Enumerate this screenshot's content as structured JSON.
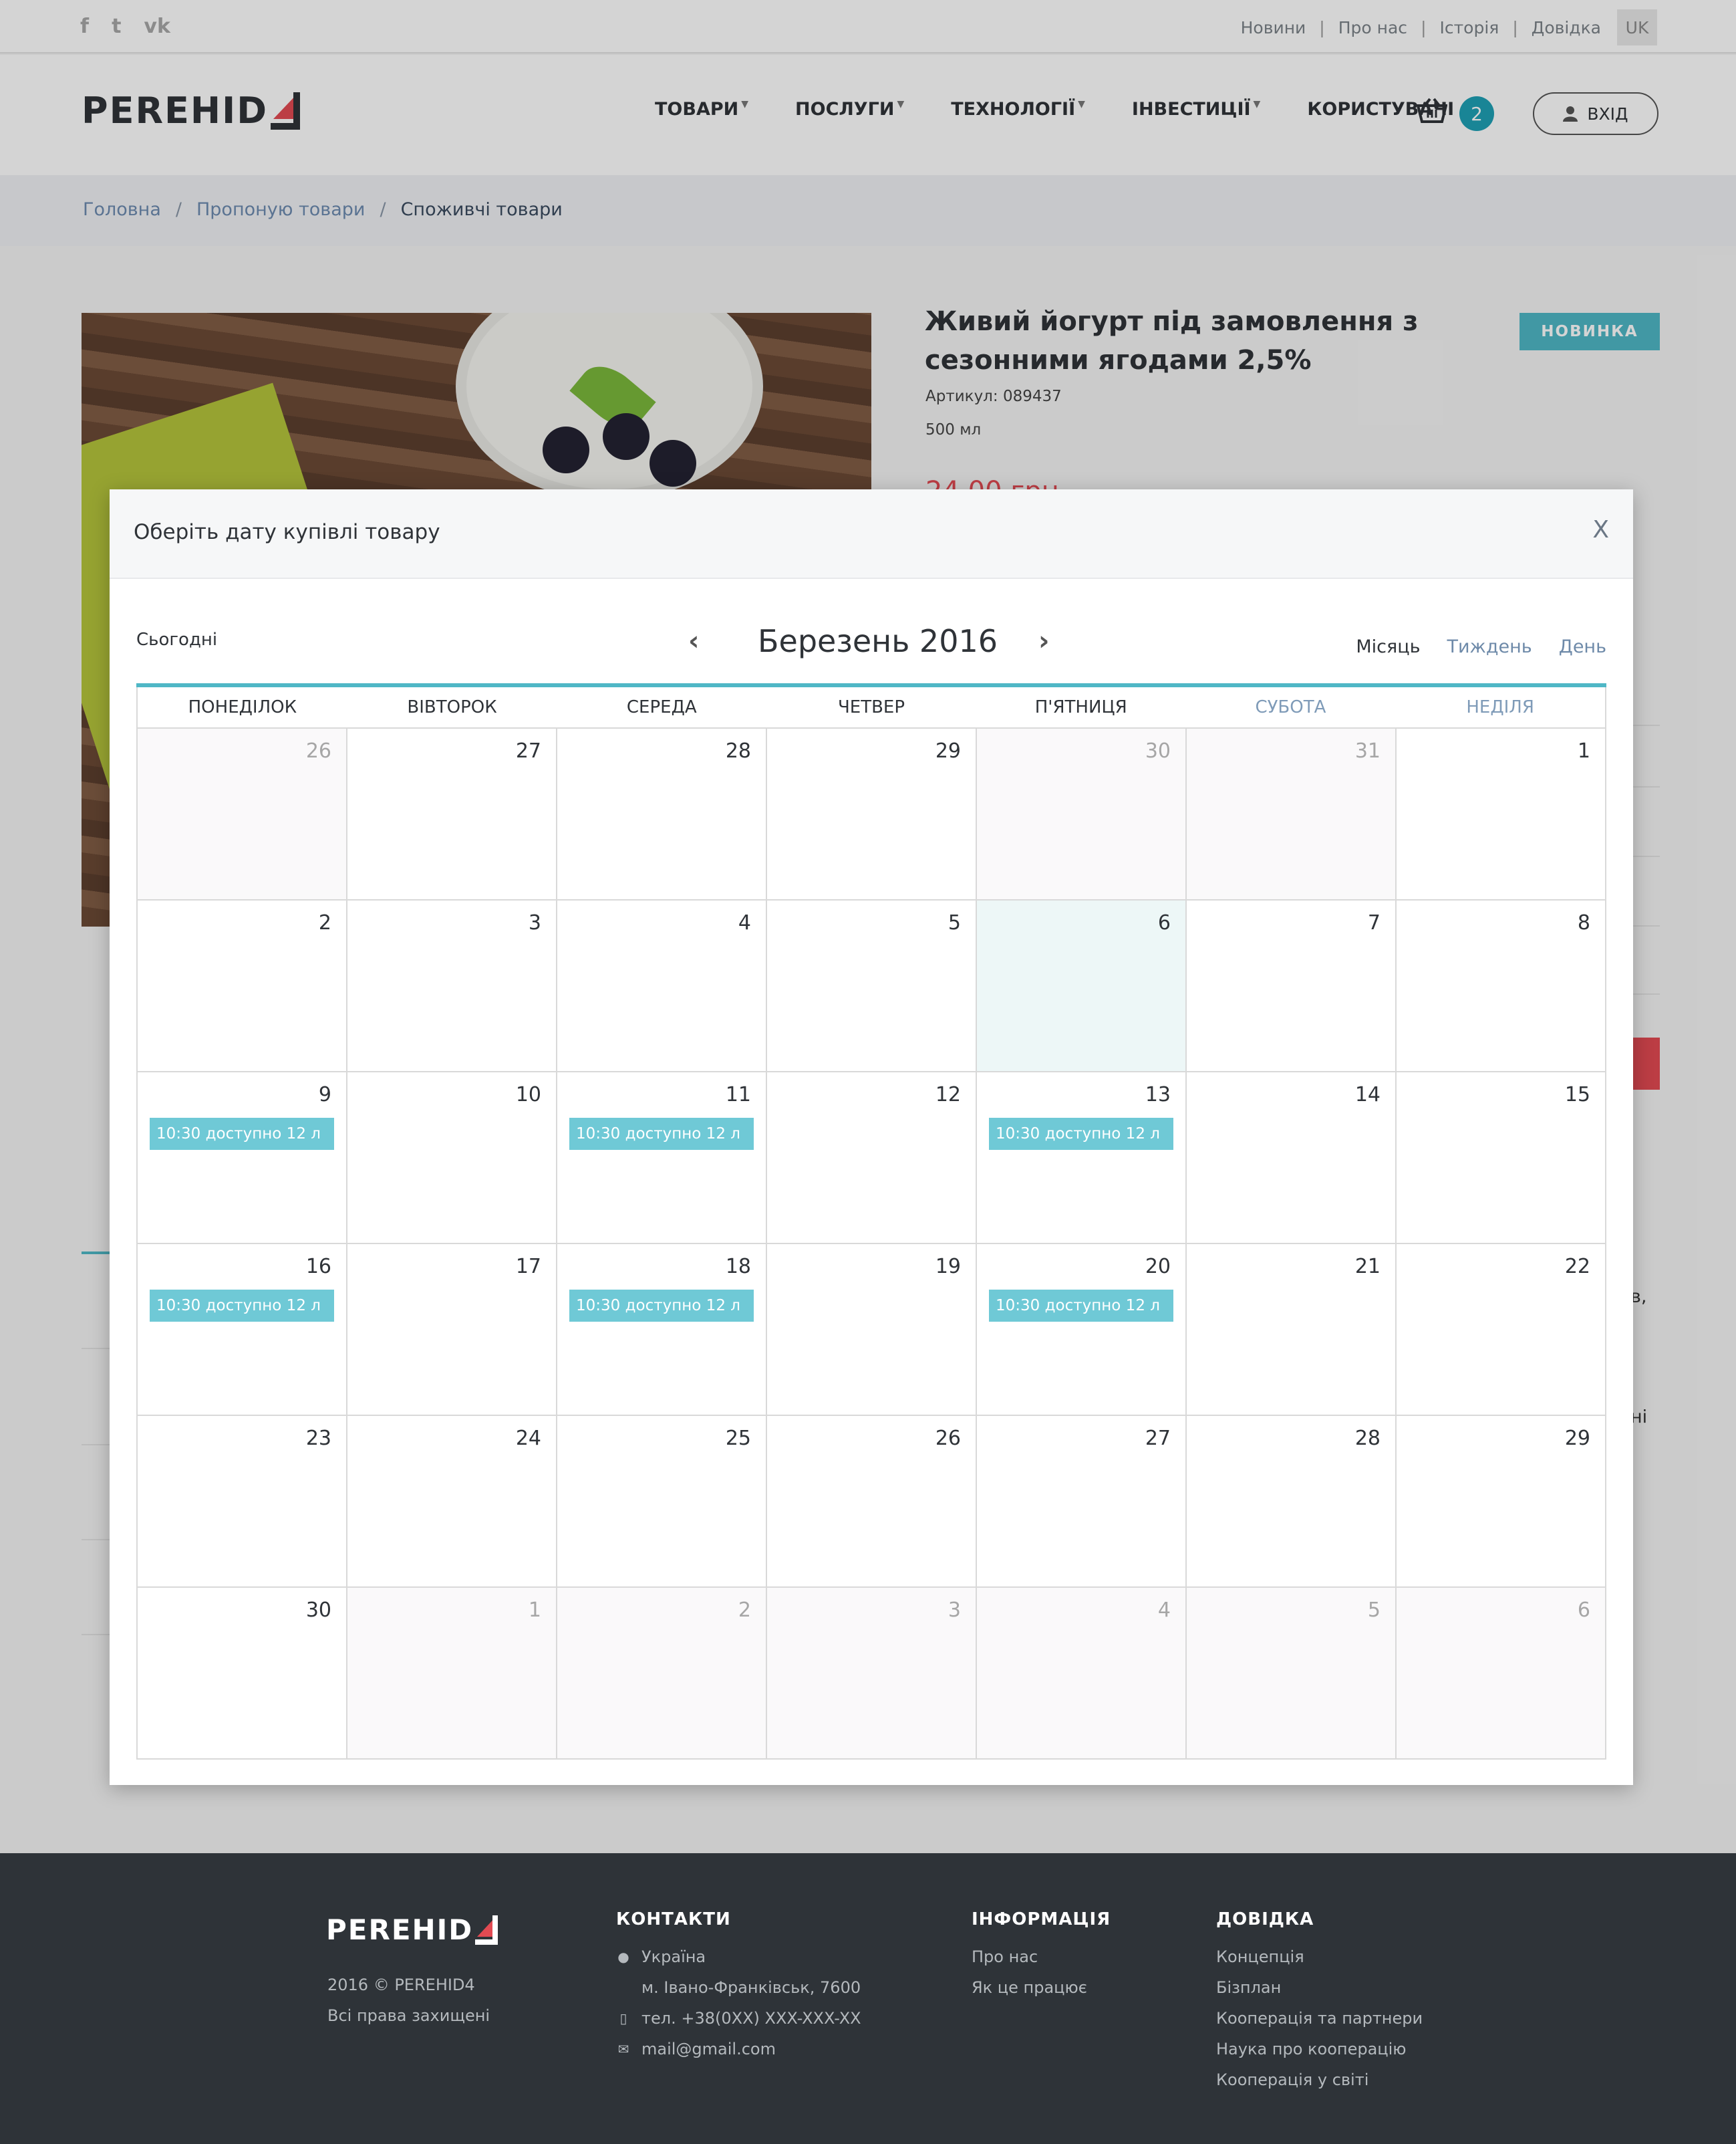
{
  "topbar": {
    "social": [
      "facebook-icon",
      "twitter-icon",
      "vk-icon"
    ],
    "links": [
      "Новини",
      "Про нас",
      "Історія",
      "Довідка"
    ],
    "lang": "UK"
  },
  "header": {
    "logo_text": "PEREHID",
    "nav": [
      "ТОВАРИ",
      "ПОСЛУГИ",
      "ТЕХНОЛОГІЇ",
      "ІНВЕСТИЦІЇ",
      "КОРИСТУВАЧІ"
    ],
    "cart_count": "2",
    "login_label": "ВХІД"
  },
  "breadcrumb": {
    "items": [
      "Головна",
      "Пропоную товари",
      "Споживчі товари"
    ],
    "separator": "/"
  },
  "product": {
    "title": "Живий йогурт під замовлення з сезонними ягодами 2,5%",
    "article": "Артикул: 089437",
    "volume": "500 мл",
    "price": "24,00 грн",
    "badge": "НОВИНКА",
    "side_text_1": "в,",
    "side_text_2": "ні"
  },
  "modal": {
    "title": "Оберіть дату купівлі товару",
    "close": "X"
  },
  "calendar": {
    "today_label": "Сьогодні",
    "month_label": "Березень 2016",
    "views": [
      "Місяць",
      "Тиждень",
      "День"
    ],
    "active_view": "Місяць",
    "weekdays": [
      "ПОНЕДІЛОК",
      "ВІВТОРОК",
      "СЕРЕДА",
      "ЧЕТВЕР",
      "П'ЯТНИЦЯ",
      "СУБОТА",
      "НЕДІЛЯ"
    ],
    "weeks": [
      [
        {
          "d": "26",
          "m": true
        },
        {
          "d": "27"
        },
        {
          "d": "28"
        },
        {
          "d": "29"
        },
        {
          "d": "30",
          "m": true
        },
        {
          "d": "31",
          "m": true
        },
        {
          "d": "1"
        }
      ],
      [
        {
          "d": "2"
        },
        {
          "d": "3"
        },
        {
          "d": "4"
        },
        {
          "d": "5"
        },
        {
          "d": "6",
          "today": true
        },
        {
          "d": "7"
        },
        {
          "d": "8"
        }
      ],
      [
        {
          "d": "9",
          "e": "10:30 доступно 12 л"
        },
        {
          "d": "10"
        },
        {
          "d": "11",
          "e": "10:30 доступно 12 л"
        },
        {
          "d": "12"
        },
        {
          "d": "13",
          "e": "10:30 доступно 12 л"
        },
        {
          "d": "14"
        },
        {
          "d": "15"
        }
      ],
      [
        {
          "d": "16",
          "e": "10:30 доступно 12 л"
        },
        {
          "d": "17"
        },
        {
          "d": "18",
          "e": "10:30 доступно 12 л"
        },
        {
          "d": "19"
        },
        {
          "d": "20",
          "e": "10:30 доступно 12 л"
        },
        {
          "d": "21"
        },
        {
          "d": "22"
        }
      ],
      [
        {
          "d": "23"
        },
        {
          "d": "24"
        },
        {
          "d": "25"
        },
        {
          "d": "26"
        },
        {
          "d": "27"
        },
        {
          "d": "28"
        },
        {
          "d": "29"
        }
      ],
      [
        {
          "d": "30"
        },
        {
          "d": "1",
          "m": true
        },
        {
          "d": "2",
          "m": true
        },
        {
          "d": "3",
          "m": true
        },
        {
          "d": "4",
          "m": true
        },
        {
          "d": "5",
          "m": true
        },
        {
          "d": "6",
          "m": true
        }
      ]
    ]
  },
  "footer": {
    "logo_text": "PEREHID",
    "copyright": "2016 © PEREHID4",
    "rights": "Всі права захищені",
    "contacts_title": "КОНТАКТИ",
    "contacts": {
      "country": "Україна",
      "city": "м. Івано-Франківськ, 7600",
      "phone": "тел. +38(0XX) XXX-XXX-XX",
      "email": "mail@gmail.com"
    },
    "info_title": "ІНФОРМАЦІЯ",
    "info_links": [
      "Про нас",
      "Як це працює"
    ],
    "help_title": "ДОВІДКА",
    "help_links": [
      "Концепція",
      "Бізплан",
      "Кооперація та партнери",
      "Наука про кооперацію",
      "Кооперація у світі"
    ]
  }
}
